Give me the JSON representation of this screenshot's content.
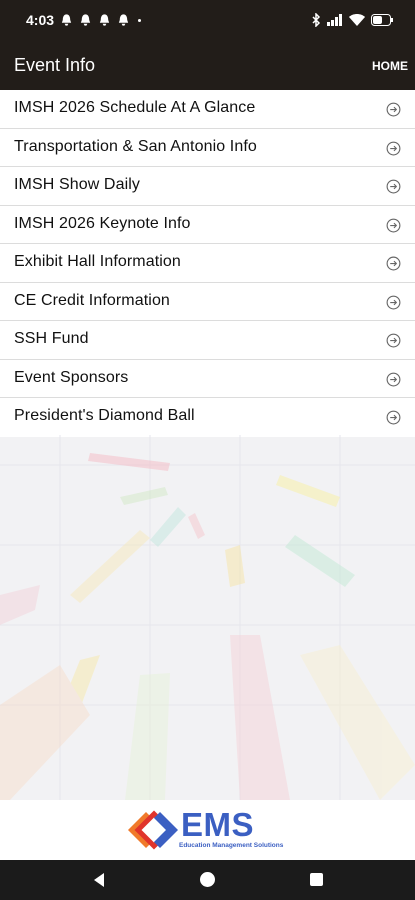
{
  "status_bar": {
    "time": "4:03",
    "notification_icons": [
      "notification-icon",
      "notification-icon",
      "notification-icon",
      "notification-icon"
    ],
    "system_icons": [
      "bluetooth-icon",
      "signal-icon",
      "wifi-icon",
      "battery-icon"
    ]
  },
  "app_bar": {
    "title": "Event Info",
    "home_label": "HOME"
  },
  "menu": {
    "items": [
      {
        "label": "IMSH 2026 Schedule At A Glance"
      },
      {
        "label": "Transportation & San Antonio Info"
      },
      {
        "label": "IMSH Show Daily"
      },
      {
        "label": "IMSH 2026 Keynote Info"
      },
      {
        "label": "Exhibit Hall Information"
      },
      {
        "label": "CE Credit Information"
      },
      {
        "label": "SSH Fund"
      },
      {
        "label": "Event Sponsors"
      },
      {
        "label": "President's Diamond Ball"
      }
    ],
    "arrow_icon": "arrow-circle-right-icon"
  },
  "footer": {
    "logo_text": "EMS",
    "logo_subtitle": "Education Management Solutions"
  },
  "colors": {
    "header_bg": "#221d19",
    "logo_blue": "#3b5fc2",
    "logo_orange": "#f07a2b",
    "logo_red": "#e0342c"
  }
}
